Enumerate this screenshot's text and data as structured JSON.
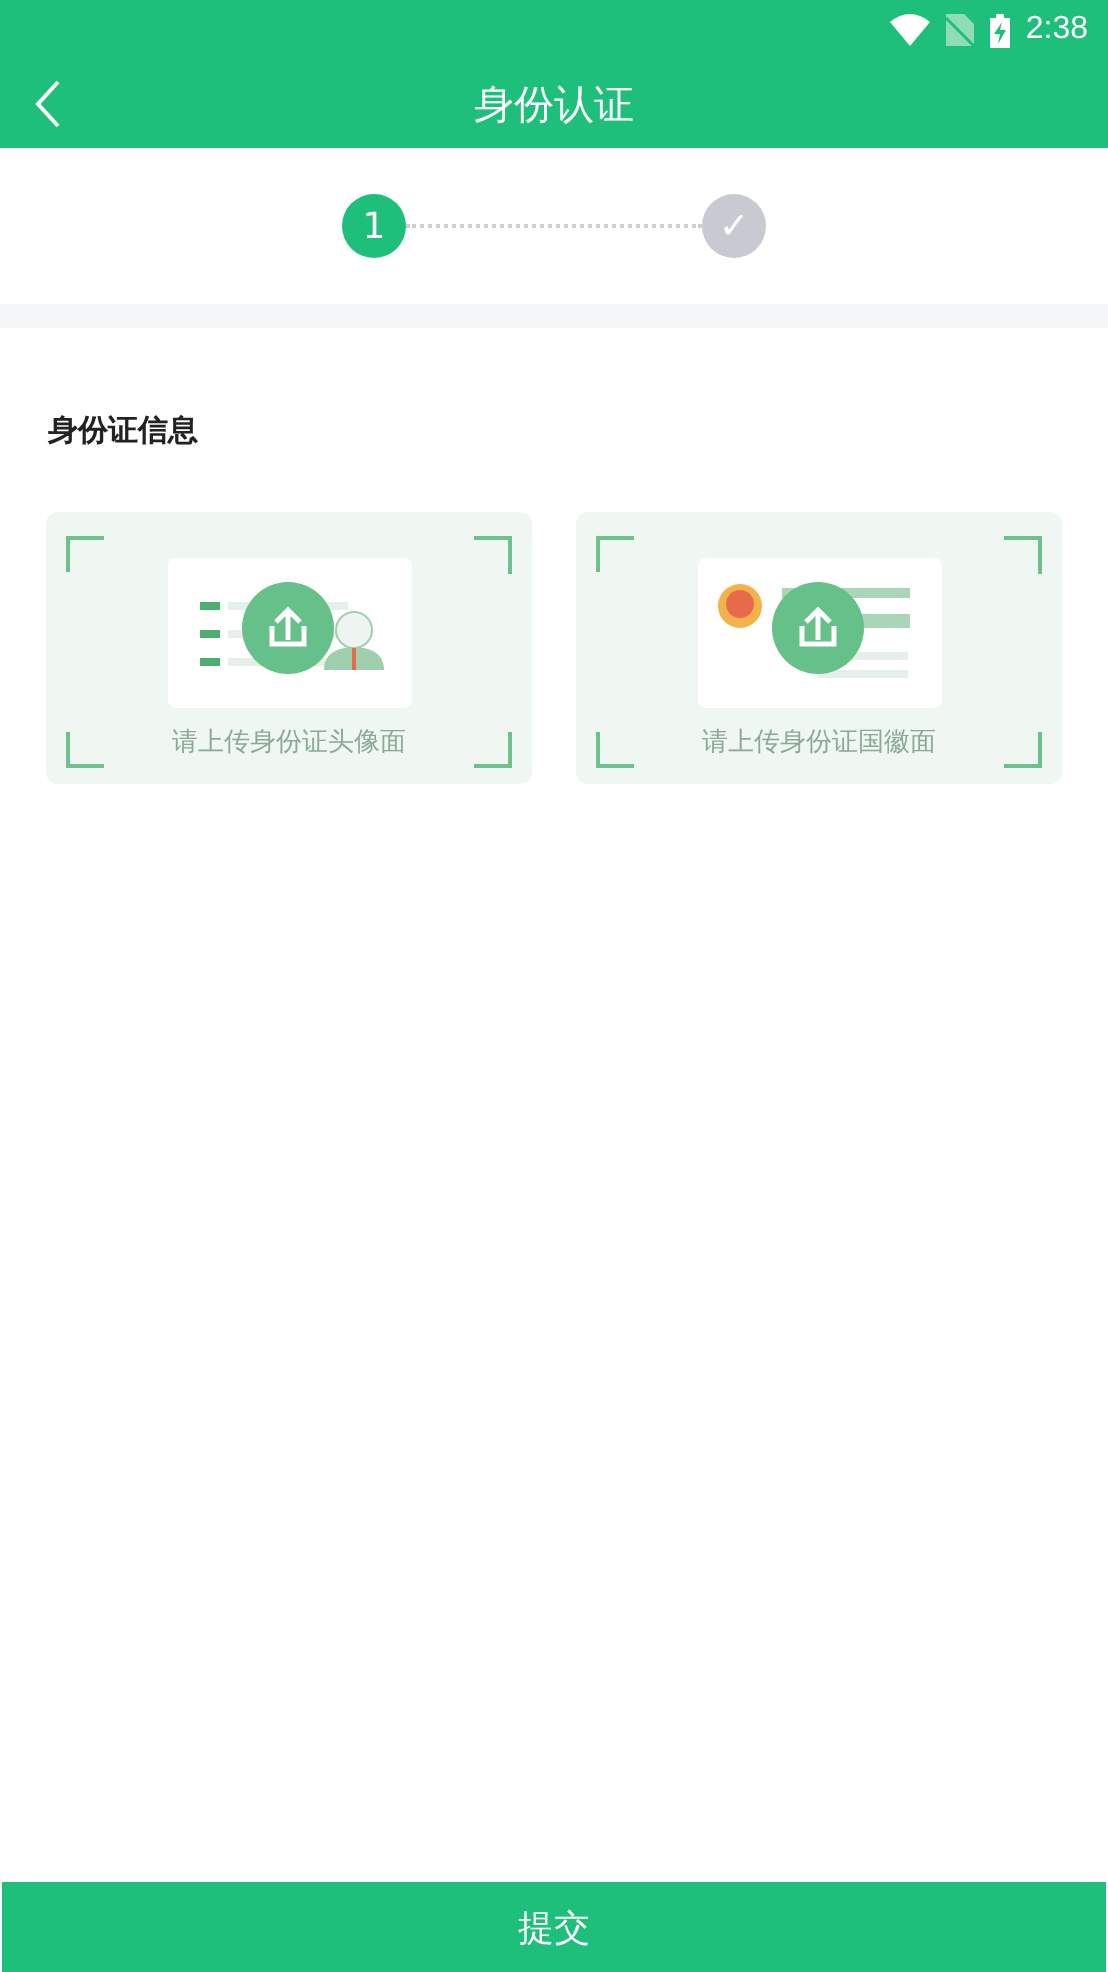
{
  "status_bar": {
    "time": "2:38"
  },
  "app_bar": {
    "title": "身份认证"
  },
  "steps": [
    {
      "label": "1",
      "active": true
    },
    {
      "label": "✓",
      "active": false
    }
  ],
  "section": {
    "title": "身份证信息"
  },
  "uploads": [
    {
      "kind": "portrait",
      "caption": "请上传身份证头像面"
    },
    {
      "kind": "emblem",
      "caption": "请上传身份证国徽面"
    }
  ],
  "submit": {
    "label": "提交"
  }
}
